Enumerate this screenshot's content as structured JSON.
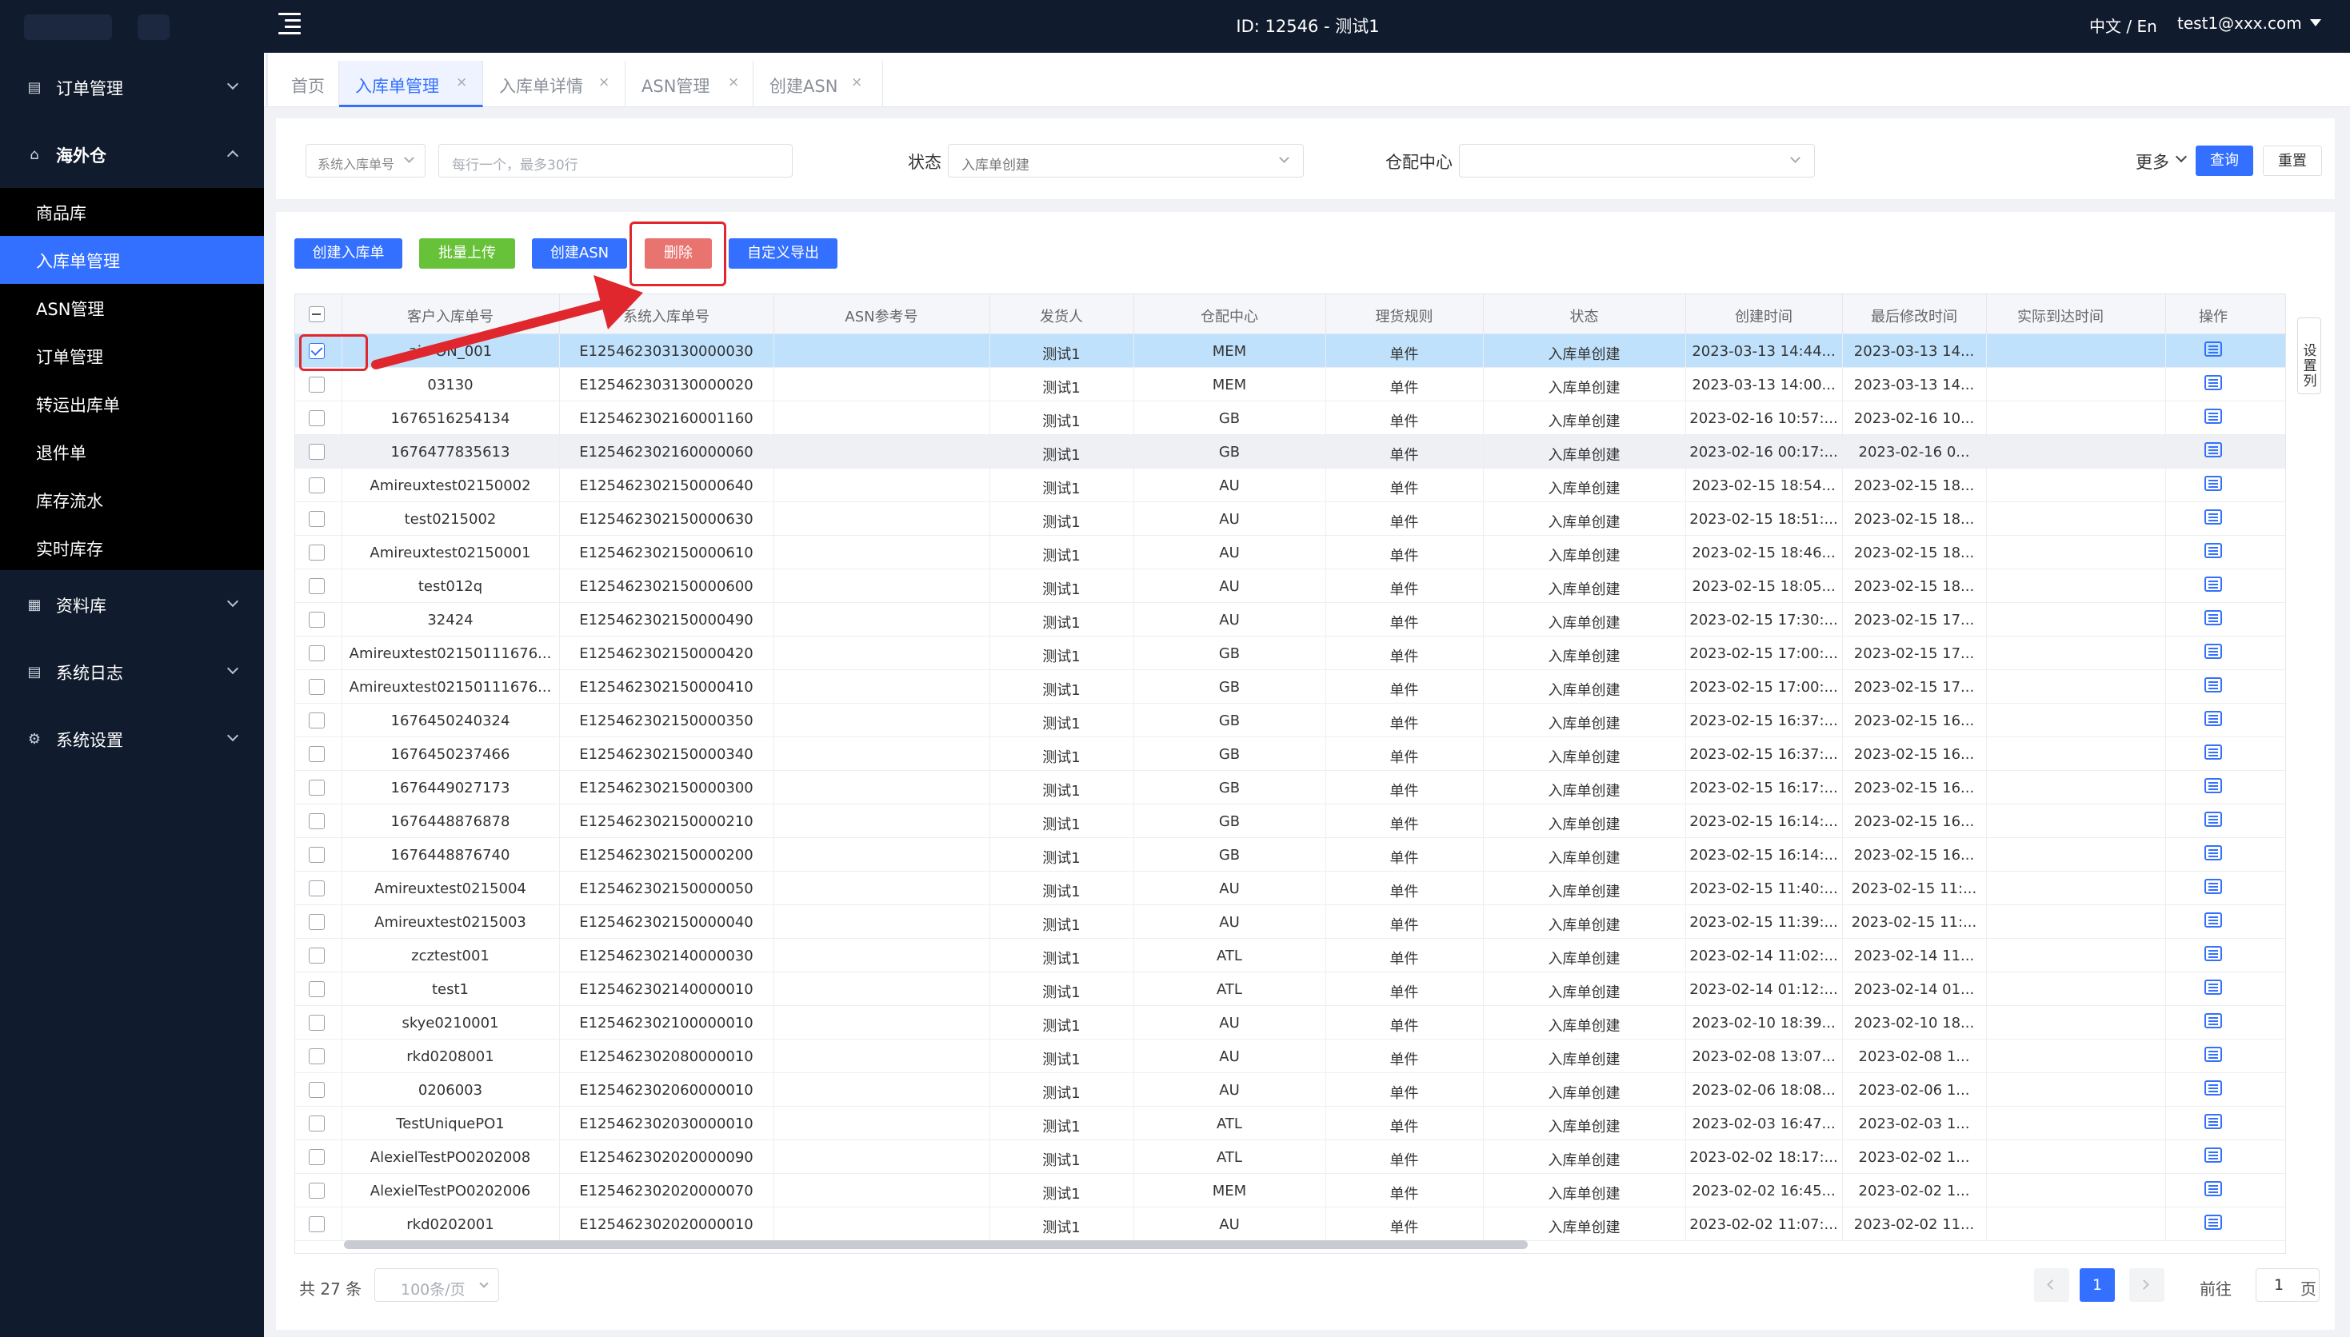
{
  "header": {
    "title": "ID: 12546 - 测试1",
    "lang": "中文 / En",
    "user": "test1@xxx.com"
  },
  "sidebar": {
    "order_mgmt": "订单管理",
    "overseas": "海外仓",
    "sub_items": [
      "商品库",
      "入库单管理",
      "ASN管理",
      "订单管理",
      "转运出库单",
      "退件单",
      "库存流水",
      "实时库存"
    ],
    "active_sub": "入库单管理",
    "data_lib": "资料库",
    "sys_log": "系统日志",
    "sys_settings": "系统设置"
  },
  "tabs": [
    {
      "label": "首页",
      "closable": false
    },
    {
      "label": "入库单管理",
      "closable": true,
      "active": true
    },
    {
      "label": "入库单详情",
      "closable": true
    },
    {
      "label": "ASN管理",
      "closable": true
    },
    {
      "label": "创建ASN",
      "closable": true
    }
  ],
  "tab_close_glyph": "×",
  "filter": {
    "field_select": "系统入库单号",
    "field_placeholder": "每行一个，最多30行",
    "status_label": "状态",
    "status_placeholder": "入库单创建",
    "warehouse_label": "仓配中心",
    "warehouse_value": "",
    "more": "更多",
    "query": "查询",
    "reset": "重置"
  },
  "actions": {
    "create": "创建入库单",
    "batch_upload": "批量上传",
    "create_asn": "创建ASN",
    "delete": "删除",
    "export": "自定义导出"
  },
  "table": {
    "columns": [
      "客户入库单号",
      "系统入库单号",
      "ASN参考号",
      "发货人",
      "仓配中心",
      "理货规则",
      "状态",
      "创建时间",
      "最后修改时间",
      "实际到达时间",
      "操作"
    ],
    "settings_label": "设置列",
    "rows": [
      {
        "cust": "ai···ON_001",
        "sys": "E125462303130000030",
        "asn": "",
        "shipper": "测试1",
        "wh": "MEM",
        "rule": "单件",
        "status": "入库单创建",
        "created": "2023-03-13 14:44...",
        "modified": "2023-03-13 14...",
        "arrival": "",
        "selected": true
      },
      {
        "cust": "03130",
        "sys": "E125462303130000020",
        "asn": "",
        "shipper": "测试1",
        "wh": "MEM",
        "rule": "单件",
        "status": "入库单创建",
        "created": "2023-03-13 14:00...",
        "modified": "2023-03-13 14...",
        "arrival": ""
      },
      {
        "cust": "1676516254134",
        "sys": "E125462302160001160",
        "asn": "",
        "shipper": "测试1",
        "wh": "GB",
        "rule": "单件",
        "status": "入库单创建",
        "created": "2023-02-16 10:57:...",
        "modified": "2023-02-16 10...",
        "arrival": ""
      },
      {
        "cust": "1676477835613",
        "sys": "E125462302160000060",
        "asn": "",
        "shipper": "测试1",
        "wh": "GB",
        "rule": "单件",
        "status": "入库单创建",
        "created": "2023-02-16 00:17:...",
        "modified": "2023-02-16 0...",
        "arrival": ""
      },
      {
        "cust": "Amireuxtest02150002",
        "sys": "E125462302150000640",
        "asn": "",
        "shipper": "测试1",
        "wh": "AU",
        "rule": "单件",
        "status": "入库单创建",
        "created": "2023-02-15 18:54...",
        "modified": "2023-02-15 18...",
        "arrival": ""
      },
      {
        "cust": "test0215002",
        "sys": "E125462302150000630",
        "asn": "",
        "shipper": "测试1",
        "wh": "AU",
        "rule": "单件",
        "status": "入库单创建",
        "created": "2023-02-15 18:51:...",
        "modified": "2023-02-15 18...",
        "arrival": ""
      },
      {
        "cust": "Amireuxtest02150001",
        "sys": "E125462302150000610",
        "asn": "",
        "shipper": "测试1",
        "wh": "AU",
        "rule": "单件",
        "status": "入库单创建",
        "created": "2023-02-15 18:46...",
        "modified": "2023-02-15 18...",
        "arrival": ""
      },
      {
        "cust": "test012q",
        "sys": "E125462302150000600",
        "asn": "",
        "shipper": "测试1",
        "wh": "AU",
        "rule": "单件",
        "status": "入库单创建",
        "created": "2023-02-15 18:05...",
        "modified": "2023-02-15 18...",
        "arrival": ""
      },
      {
        "cust": "32424",
        "sys": "E125462302150000490",
        "asn": "",
        "shipper": "测试1",
        "wh": "AU",
        "rule": "单件",
        "status": "入库单创建",
        "created": "2023-02-15 17:30:...",
        "modified": "2023-02-15 17...",
        "arrival": ""
      },
      {
        "cust": "Amireuxtest02150111676...",
        "sys": "E125462302150000420",
        "asn": "",
        "shipper": "测试1",
        "wh": "GB",
        "rule": "单件",
        "status": "入库单创建",
        "created": "2023-02-15 17:00:...",
        "modified": "2023-02-15 17...",
        "arrival": ""
      },
      {
        "cust": "Amireuxtest02150111676...",
        "sys": "E125462302150000410",
        "asn": "",
        "shipper": "测试1",
        "wh": "GB",
        "rule": "单件",
        "status": "入库单创建",
        "created": "2023-02-15 17:00:...",
        "modified": "2023-02-15 17...",
        "arrival": ""
      },
      {
        "cust": "1676450240324",
        "sys": "E125462302150000350",
        "asn": "",
        "shipper": "测试1",
        "wh": "GB",
        "rule": "单件",
        "status": "入库单创建",
        "created": "2023-02-15 16:37:...",
        "modified": "2023-02-15 16...",
        "arrival": ""
      },
      {
        "cust": "1676450237466",
        "sys": "E125462302150000340",
        "asn": "",
        "shipper": "测试1",
        "wh": "GB",
        "rule": "单件",
        "status": "入库单创建",
        "created": "2023-02-15 16:37:...",
        "modified": "2023-02-15 16...",
        "arrival": ""
      },
      {
        "cust": "1676449027173",
        "sys": "E125462302150000300",
        "asn": "",
        "shipper": "测试1",
        "wh": "GB",
        "rule": "单件",
        "status": "入库单创建",
        "created": "2023-02-15 16:17:...",
        "modified": "2023-02-15 16...",
        "arrival": ""
      },
      {
        "cust": "1676448876878",
        "sys": "E125462302150000210",
        "asn": "",
        "shipper": "测试1",
        "wh": "GB",
        "rule": "单件",
        "status": "入库单创建",
        "created": "2023-02-15 16:14:...",
        "modified": "2023-02-15 16...",
        "arrival": ""
      },
      {
        "cust": "1676448876740",
        "sys": "E125462302150000200",
        "asn": "",
        "shipper": "测试1",
        "wh": "GB",
        "rule": "单件",
        "status": "入库单创建",
        "created": "2023-02-15 16:14:...",
        "modified": "2023-02-15 16...",
        "arrival": ""
      },
      {
        "cust": "Amireuxtest0215004",
        "sys": "E125462302150000050",
        "asn": "",
        "shipper": "测试1",
        "wh": "AU",
        "rule": "单件",
        "status": "入库单创建",
        "created": "2023-02-15 11:40:...",
        "modified": "2023-02-15 11:...",
        "arrival": ""
      },
      {
        "cust": "Amireuxtest0215003",
        "sys": "E125462302150000040",
        "asn": "",
        "shipper": "测试1",
        "wh": "AU",
        "rule": "单件",
        "status": "入库单创建",
        "created": "2023-02-15 11:39:...",
        "modified": "2023-02-15 11:...",
        "arrival": ""
      },
      {
        "cust": "zcztest001",
        "sys": "E125462302140000030",
        "asn": "",
        "shipper": "测试1",
        "wh": "ATL",
        "rule": "单件",
        "status": "入库单创建",
        "created": "2023-02-14 11:02:...",
        "modified": "2023-02-14 11...",
        "arrival": ""
      },
      {
        "cust": "test1",
        "sys": "E125462302140000010",
        "asn": "",
        "shipper": "测试1",
        "wh": "ATL",
        "rule": "单件",
        "status": "入库单创建",
        "created": "2023-02-14 01:12:...",
        "modified": "2023-02-14 01...",
        "arrival": ""
      },
      {
        "cust": "skye0210001",
        "sys": "E125462302100000010",
        "asn": "",
        "shipper": "测试1",
        "wh": "AU",
        "rule": "单件",
        "status": "入库单创建",
        "created": "2023-02-10 18:39...",
        "modified": "2023-02-10 18...",
        "arrival": ""
      },
      {
        "cust": "rkd0208001",
        "sys": "E125462302080000010",
        "asn": "",
        "shipper": "测试1",
        "wh": "AU",
        "rule": "单件",
        "status": "入库单创建",
        "created": "2023-02-08 13:07...",
        "modified": "2023-02-08 1...",
        "arrival": ""
      },
      {
        "cust": "0206003",
        "sys": "E125462302060000010",
        "asn": "",
        "shipper": "测试1",
        "wh": "AU",
        "rule": "单件",
        "status": "入库单创建",
        "created": "2023-02-06 18:08...",
        "modified": "2023-02-06 1...",
        "arrival": ""
      },
      {
        "cust": "TestUniquePO1",
        "sys": "E125462302030000010",
        "asn": "",
        "shipper": "测试1",
        "wh": "ATL",
        "rule": "单件",
        "status": "入库单创建",
        "created": "2023-02-03 16:47...",
        "modified": "2023-02-03 1...",
        "arrival": ""
      },
      {
        "cust": "AlexielTestPO0202008",
        "sys": "E125462302020000090",
        "asn": "",
        "shipper": "测试1",
        "wh": "ATL",
        "rule": "单件",
        "status": "入库单创建",
        "created": "2023-02-02 18:17:...",
        "modified": "2023-02-02 1...",
        "arrival": ""
      },
      {
        "cust": "AlexielTestPO0202006",
        "sys": "E125462302020000070",
        "asn": "",
        "shipper": "测试1",
        "wh": "MEM",
        "rule": "单件",
        "status": "入库单创建",
        "created": "2023-02-02 16:45...",
        "modified": "2023-02-02 1...",
        "arrival": ""
      },
      {
        "cust": "rkd0202001",
        "sys": "E125462302020000010",
        "asn": "",
        "shipper": "测试1",
        "wh": "AU",
        "rule": "单件",
        "status": "入库单创建",
        "created": "2023-02-02 11:07:...",
        "modified": "2023-02-02 11...",
        "arrival": ""
      }
    ]
  },
  "pagination": {
    "total": "共 27 条",
    "page_size": "100条/页",
    "current": "1",
    "goto_label": "前往",
    "goto_value": "1",
    "page_suffix": "页"
  },
  "colors": {
    "primary": "#3370ff",
    "sidebar_bg": "#101b2d",
    "upload_green": "#67c23a",
    "delete_red": "#e8736f",
    "annotation_red": "#e0272e"
  },
  "icons": {
    "menu": "menu-toggle-icon",
    "order": "order-icon",
    "warehouse": "warehouse-icon",
    "data": "data-library-icon",
    "log": "log-icon",
    "settings": "gear-icon",
    "op": "detail-icon"
  }
}
